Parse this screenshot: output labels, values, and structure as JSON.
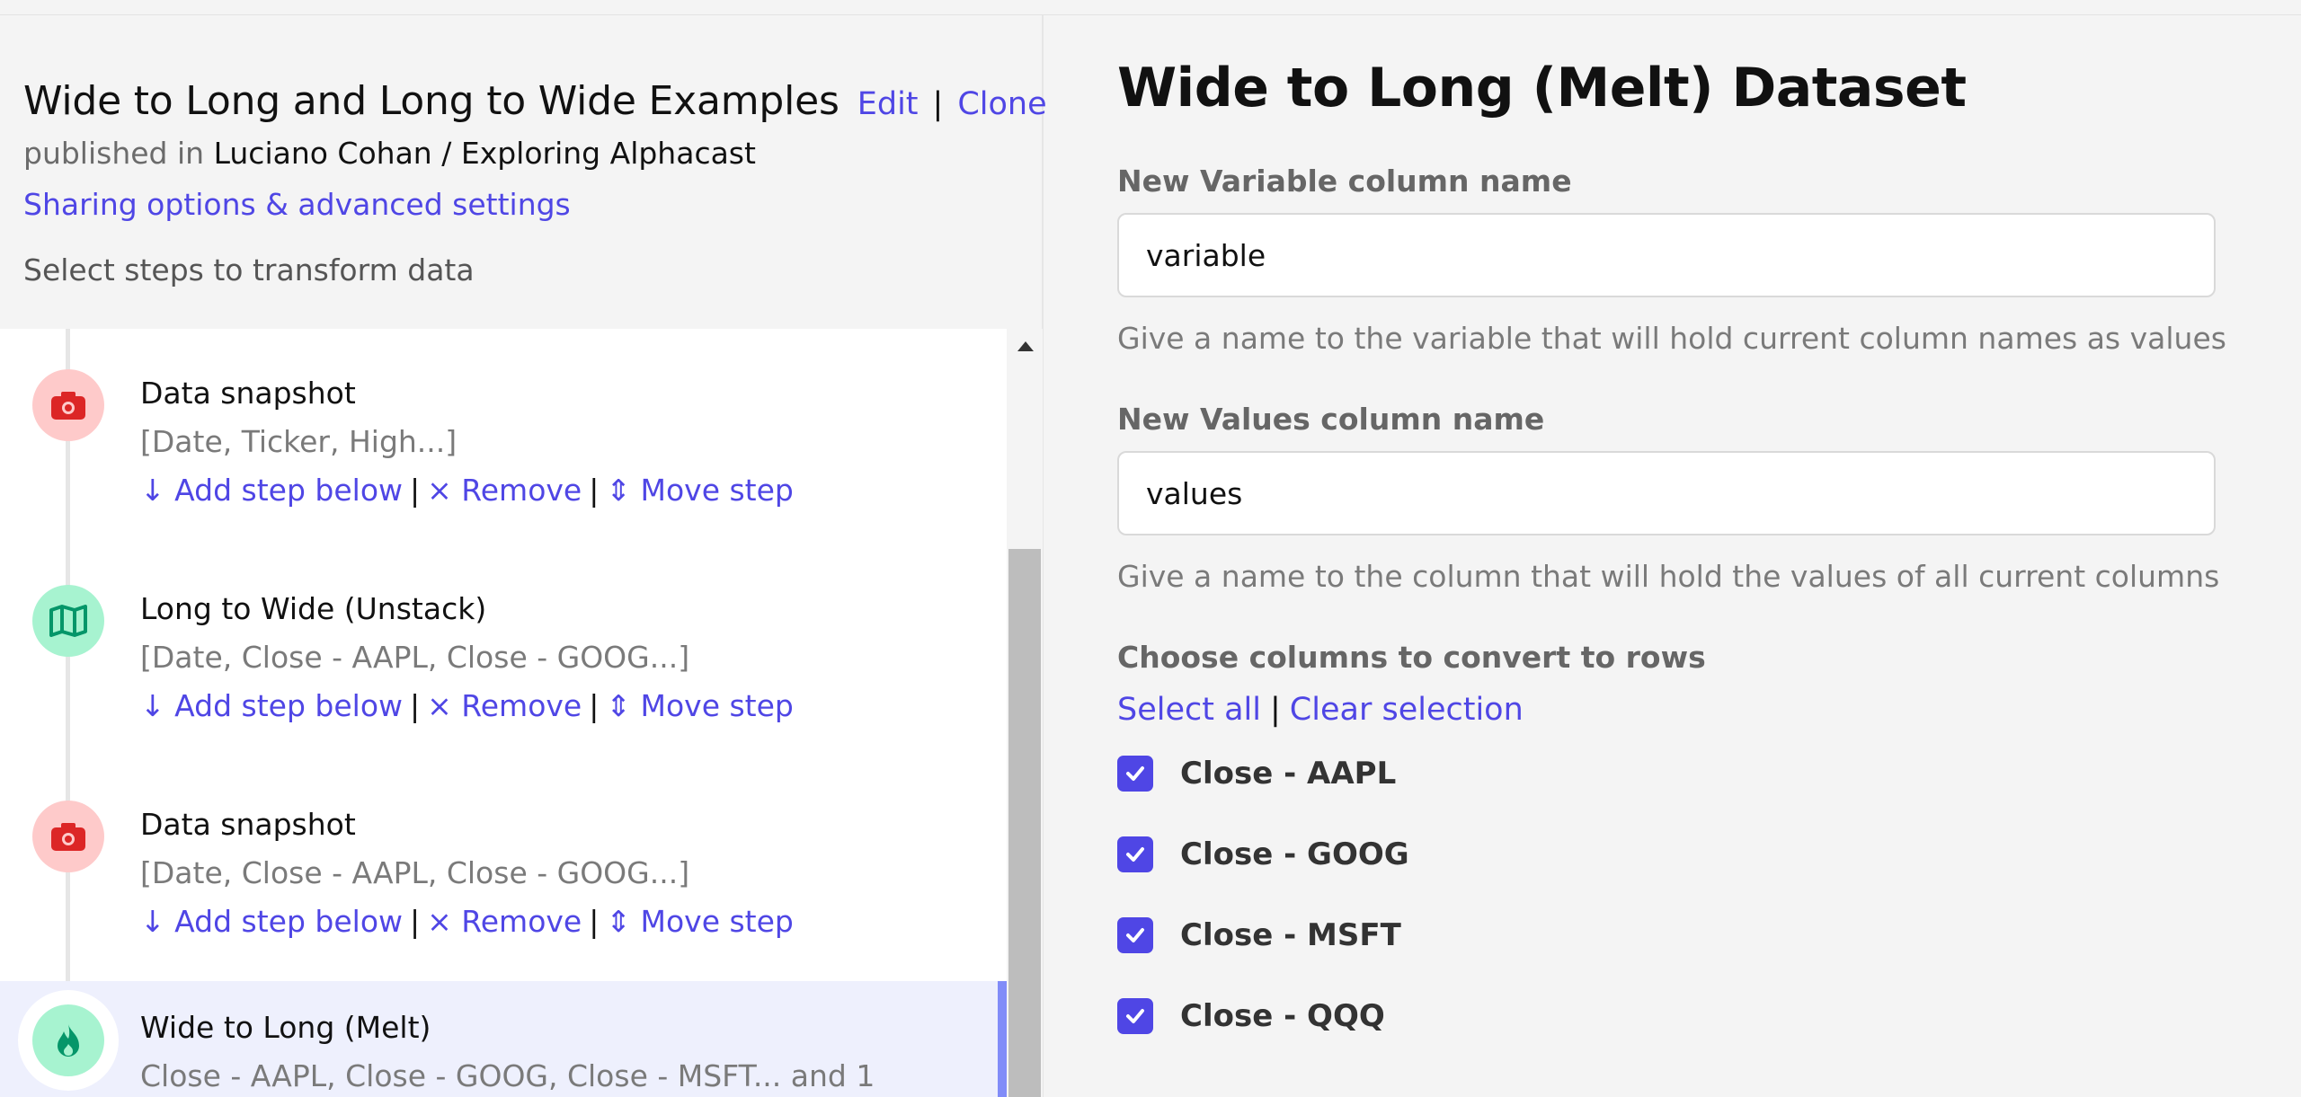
{
  "header": {
    "title": "Wide to Long and Long to Wide Examples",
    "edit_label": "Edit",
    "separator": "|",
    "clone_label": "Clone",
    "published_prefix": "published in",
    "owner": "Luciano Cohan",
    "path_separator": "/",
    "project": "Exploring Alphacast",
    "sharing_link": "Sharing options & advanced settings",
    "steps_hint": "Select steps to transform data"
  },
  "step_actions": {
    "add": "Add step below",
    "remove": "Remove",
    "move": "Move step",
    "separator": "|"
  },
  "steps": [
    {
      "name": "Data snapshot",
      "columns": "[Date, Ticker, High...]",
      "icon": "camera-icon",
      "color": "#dc2626"
    },
    {
      "name": "Long to Wide (Unstack)",
      "columns": "[Date, Close - AAPL, Close - GOOG...]",
      "icon": "map-icon",
      "color": "#059669"
    },
    {
      "name": "Data snapshot",
      "columns": "[Date, Close - AAPL, Close - GOOG...]",
      "icon": "camera-icon",
      "color": "#dc2626"
    },
    {
      "name": "Wide to Long (Melt)",
      "columns": "Close - AAPL, Close - GOOG, Close - MSFT... and 1",
      "icon": "fire-icon",
      "color": "#059669",
      "selected": true
    }
  ],
  "form": {
    "title": "Wide to Long (Melt) Dataset",
    "variable_label": "New Variable column name",
    "variable_value": "variable",
    "variable_help": "Give a name to the variable that will hold current column names as values",
    "values_label": "New Values column name",
    "values_value": "values",
    "values_help": "Give a name to the column that will hold the values of all current columns",
    "columns_label": "Choose columns to convert to rows",
    "select_all": "Select all",
    "sel_separator": "|",
    "clear_selection": "Clear selection",
    "columns": [
      {
        "label": "Close - AAPL",
        "checked": true
      },
      {
        "label": "Close - GOOG",
        "checked": true
      },
      {
        "label": "Close - MSFT",
        "checked": true
      },
      {
        "label": "Close - QQQ",
        "checked": true
      }
    ]
  },
  "colors": {
    "accent": "#4f46e5",
    "selected_bg": "#eef0fd",
    "danger_icon_bg": "#fecaca",
    "success_icon_bg": "#a7f3d0"
  }
}
